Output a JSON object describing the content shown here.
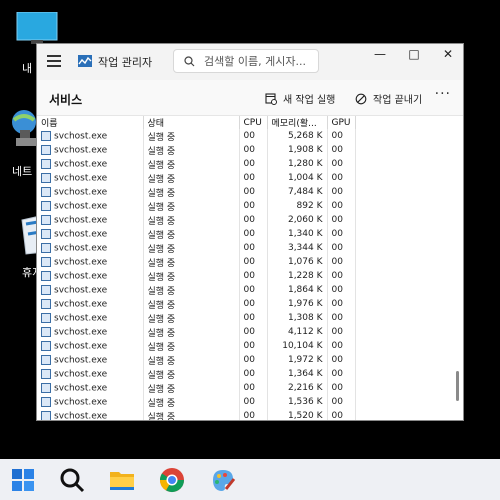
{
  "desktop": {
    "labels": [
      "내",
      "네트",
      "휴지"
    ]
  },
  "window": {
    "app_title": "작업 관리자",
    "search_placeholder": "검색할 이름, 게시자...",
    "controls": {
      "minimize": "—",
      "maximize": "□",
      "close": "✕"
    }
  },
  "toolbar": {
    "page_title": "서비스",
    "new_task_label": "새 작업 실행",
    "end_task_label": "작업 끝내기",
    "more_label": "···"
  },
  "table": {
    "columns": [
      "이름",
      "상태",
      "CPU",
      "메모리(활...",
      "GPU"
    ],
    "rows": [
      {
        "name": "svchost.exe",
        "status": "실행 중",
        "cpu": "00",
        "mem": "5,268 K",
        "gpu": "00"
      },
      {
        "name": "svchost.exe",
        "status": "실행 중",
        "cpu": "00",
        "mem": "1,908 K",
        "gpu": "00"
      },
      {
        "name": "svchost.exe",
        "status": "실행 중",
        "cpu": "00",
        "mem": "1,280 K",
        "gpu": "00"
      },
      {
        "name": "svchost.exe",
        "status": "실행 중",
        "cpu": "00",
        "mem": "1,004 K",
        "gpu": "00"
      },
      {
        "name": "svchost.exe",
        "status": "실행 중",
        "cpu": "00",
        "mem": "7,484 K",
        "gpu": "00"
      },
      {
        "name": "svchost.exe",
        "status": "실행 중",
        "cpu": "00",
        "mem": "892 K",
        "gpu": "00"
      },
      {
        "name": "svchost.exe",
        "status": "실행 중",
        "cpu": "00",
        "mem": "2,060 K",
        "gpu": "00"
      },
      {
        "name": "svchost.exe",
        "status": "실행 중",
        "cpu": "00",
        "mem": "1,340 K",
        "gpu": "00"
      },
      {
        "name": "svchost.exe",
        "status": "실행 중",
        "cpu": "00",
        "mem": "3,344 K",
        "gpu": "00"
      },
      {
        "name": "svchost.exe",
        "status": "실행 중",
        "cpu": "00",
        "mem": "1,076 K",
        "gpu": "00"
      },
      {
        "name": "svchost.exe",
        "status": "실행 중",
        "cpu": "00",
        "mem": "1,228 K",
        "gpu": "00"
      },
      {
        "name": "svchost.exe",
        "status": "실행 중",
        "cpu": "00",
        "mem": "1,864 K",
        "gpu": "00"
      },
      {
        "name": "svchost.exe",
        "status": "실행 중",
        "cpu": "00",
        "mem": "1,976 K",
        "gpu": "00"
      },
      {
        "name": "svchost.exe",
        "status": "실행 중",
        "cpu": "00",
        "mem": "1,308 K",
        "gpu": "00"
      },
      {
        "name": "svchost.exe",
        "status": "실행 중",
        "cpu": "00",
        "mem": "4,112 K",
        "gpu": "00"
      },
      {
        "name": "svchost.exe",
        "status": "실행 중",
        "cpu": "00",
        "mem": "10,104 K",
        "gpu": "00"
      },
      {
        "name": "svchost.exe",
        "status": "실행 중",
        "cpu": "00",
        "mem": "1,972 K",
        "gpu": "00"
      },
      {
        "name": "svchost.exe",
        "status": "실행 중",
        "cpu": "00",
        "mem": "1,364 K",
        "gpu": "00"
      },
      {
        "name": "svchost.exe",
        "status": "실행 중",
        "cpu": "00",
        "mem": "2,216 K",
        "gpu": "00"
      },
      {
        "name": "svchost.exe",
        "status": "실행 중",
        "cpu": "00",
        "mem": "1,536 K",
        "gpu": "00"
      },
      {
        "name": "svchost.exe",
        "status": "실행 중",
        "cpu": "00",
        "mem": "1,520 K",
        "gpu": "00"
      }
    ]
  },
  "taskbar": {
    "items": [
      "start-icon",
      "search-icon",
      "file-explorer-icon",
      "chrome-icon",
      "paint-icon"
    ]
  },
  "colors": {
    "accent": "#0078d4",
    "taskbar_bg": "#eef0f4",
    "titlebar_bg": "#f3f3f3"
  }
}
